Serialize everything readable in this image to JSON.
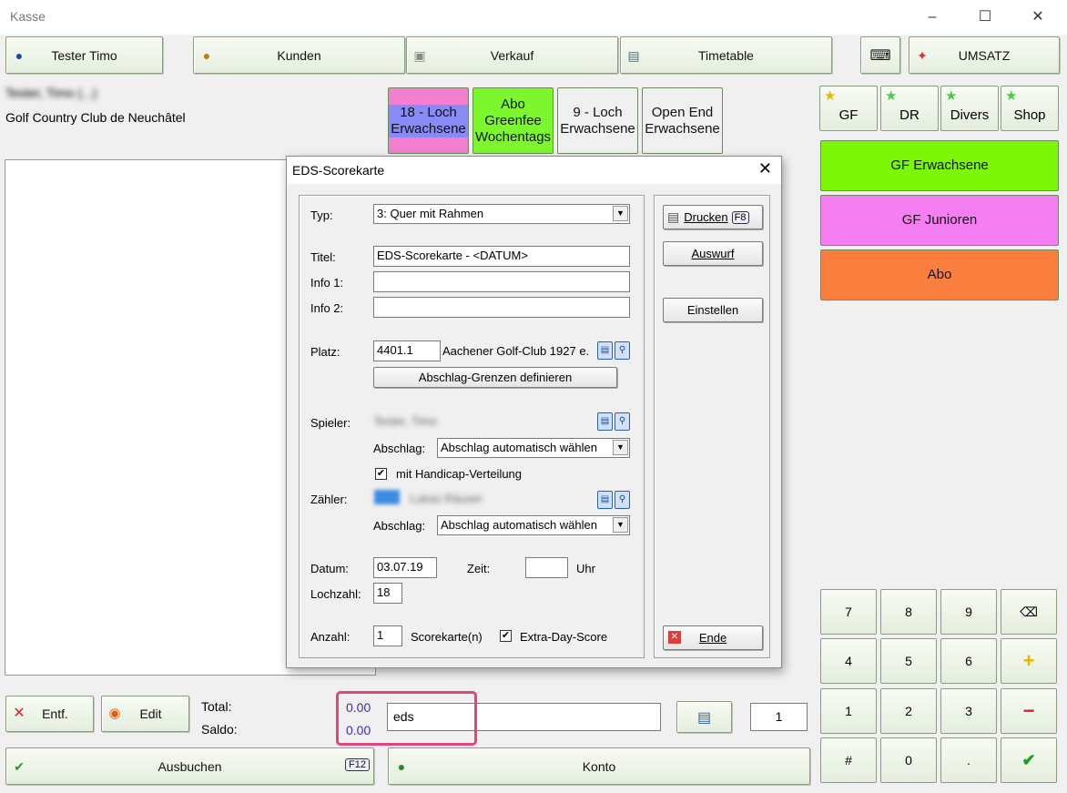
{
  "window": {
    "title": "Kasse"
  },
  "topbar": {
    "user": "Tester Timo",
    "customers": "Kunden",
    "sales": "Verkauf",
    "timetable": "Timetable",
    "revenue": "UMSATZ"
  },
  "customer": {
    "name_blurred": "Tester, Timo (...)",
    "club": "Golf  Country Club de Neuchâtel"
  },
  "product_tiles": [
    {
      "label": "18 - Loch Erwachsene",
      "color": "#f27fd0"
    },
    {
      "label": "Abo Greenfee Wochentags",
      "color": "#8a8af7"
    },
    {
      "label": "9 - Loch Erwachsene",
      "color": "#7cf72e"
    },
    {
      "label": "Open End Erwachsene",
      "color": "#7cf72e"
    }
  ],
  "categories": [
    {
      "label": "GF",
      "star_color": "#f1c40f"
    },
    {
      "label": "DR",
      "star_color": "#5bd65b"
    },
    {
      "label": "Divers",
      "star_color": "#5bd65b"
    },
    {
      "label": "Shop",
      "star_color": "#5bd65b"
    }
  ],
  "right_tiles": [
    {
      "label": "GF Erwachsene",
      "color": "#7cf707"
    },
    {
      "label": "GF Junioren",
      "color": "#f57ff2"
    },
    {
      "label": "Abo",
      "color": "#fb7f3f"
    }
  ],
  "numpad": [
    "7",
    "8",
    "9",
    "⌫",
    "4",
    "5",
    "6",
    "+",
    "1",
    "2",
    "3",
    "−",
    "#",
    "0",
    ".",
    "✔"
  ],
  "bottom": {
    "delete": "Entf.",
    "edit": "Edit",
    "total_label": "Total:",
    "saldo_label": "Saldo:",
    "total_value": "0.00",
    "saldo_value": "0.00",
    "search_value": "eds",
    "quantity": "1",
    "book": "Ausbuchen",
    "book_key": "F12",
    "account": "Konto"
  },
  "dialog": {
    "title": "EDS-Scorekarte",
    "typ_label": "Typ:",
    "typ_value": "3: Quer mit Rahmen",
    "titel_label": "Titel:",
    "titel_value": "EDS-Scorekarte - <DATUM>",
    "info1_label": "Info 1:",
    "info1_value": "",
    "info2_label": "Info 2:",
    "info2_value": "",
    "platz_label": "Platz:",
    "platz_value": "4401.1",
    "platz_name": "Aachener Golf-Club 1927 e.",
    "tee_limits_button": "Abschlag-Grenzen definieren",
    "spieler_label": "Spieler:",
    "spieler_blurred": "Tester, Timo",
    "abschlag_label": "Abschlag:",
    "abschlag_value": "Abschlag automatisch wählen",
    "handicap_label": "mit Handicap-Verteilung",
    "handicap_checked": true,
    "zaehler_label": "Zähler:",
    "zaehler_blurred": "Lukas Räuser",
    "abschlag2_label": "Abschlag:",
    "abschlag2_value": "Abschlag automatisch wählen",
    "datum_label": "Datum:",
    "datum_value": "03.07.19",
    "zeit_label": "Zeit:",
    "zeit_value": "",
    "uhr_label": "Uhr",
    "lochzahl_label": "Lochzahl:",
    "lochzahl_value": "18",
    "anzahl_label": "Anzahl:",
    "anzahl_value": "1",
    "scorekarten_label": "Scorekarte(n)",
    "extraday_label": "Extra-Day-Score",
    "extraday_checked": true,
    "print_button": "Drucken",
    "print_key": "F8",
    "auswurf_button": "Auswurf",
    "einstellen_button": "Einstellen",
    "ende_button": "Ende"
  },
  "accent_colors": {
    "highlight_box": "#e0457b",
    "total_text": "#3a2fb0"
  }
}
